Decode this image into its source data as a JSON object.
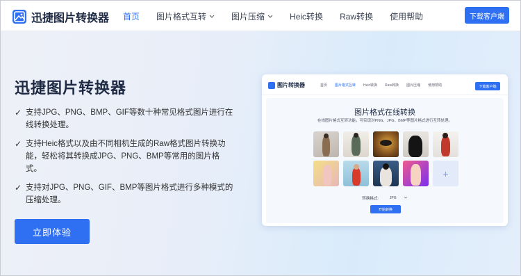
{
  "nav": {
    "logo_text": "迅捷图片转换器",
    "items": [
      {
        "label": "首页",
        "active": true,
        "dropdown": false
      },
      {
        "label": "图片格式互转",
        "active": false,
        "dropdown": true
      },
      {
        "label": "图片压缩",
        "active": false,
        "dropdown": true
      },
      {
        "label": "Heic转换",
        "active": false,
        "dropdown": false
      },
      {
        "label": "Raw转换",
        "active": false,
        "dropdown": false
      },
      {
        "label": "使用帮助",
        "active": false,
        "dropdown": false
      }
    ],
    "download_button": "下载客户端"
  },
  "hero": {
    "title": "迅捷图片转换器",
    "features": [
      "支持JPG、PNG、BMP、GIF等数十种常见格式图片进行在线转换处理。",
      "支持Heic格式以及由不同相机生成的Raw格式图片转换功能，轻松将其转换成JPG、PNG、BMP等常用的图片格式。",
      "支持对JPG、PNG、GIF、BMP等图片格式进行多种模式的压缩处理。"
    ],
    "cta_button": "立即体验"
  },
  "mockup": {
    "logo_text": "图片转换器",
    "nav_items": [
      "首页",
      "图片格式互转",
      "Heic转换",
      "Raw转换",
      "图片压缩",
      "使用帮助"
    ],
    "download_button": "下载客户端",
    "title": "图片格式在线转换",
    "subtitle": "在线图片格式互转功能，可实现对PNG、JPG、BMP等图片格式进行互转处理。",
    "format_label": "转换格式:",
    "format_value": "JPG",
    "start_button": "开始转换",
    "add_glyph": "+"
  },
  "colors": {
    "accent": "#2f6ff2",
    "title": "#1e2a44"
  },
  "icons": {
    "check": "✓",
    "chevron": "﹀"
  }
}
